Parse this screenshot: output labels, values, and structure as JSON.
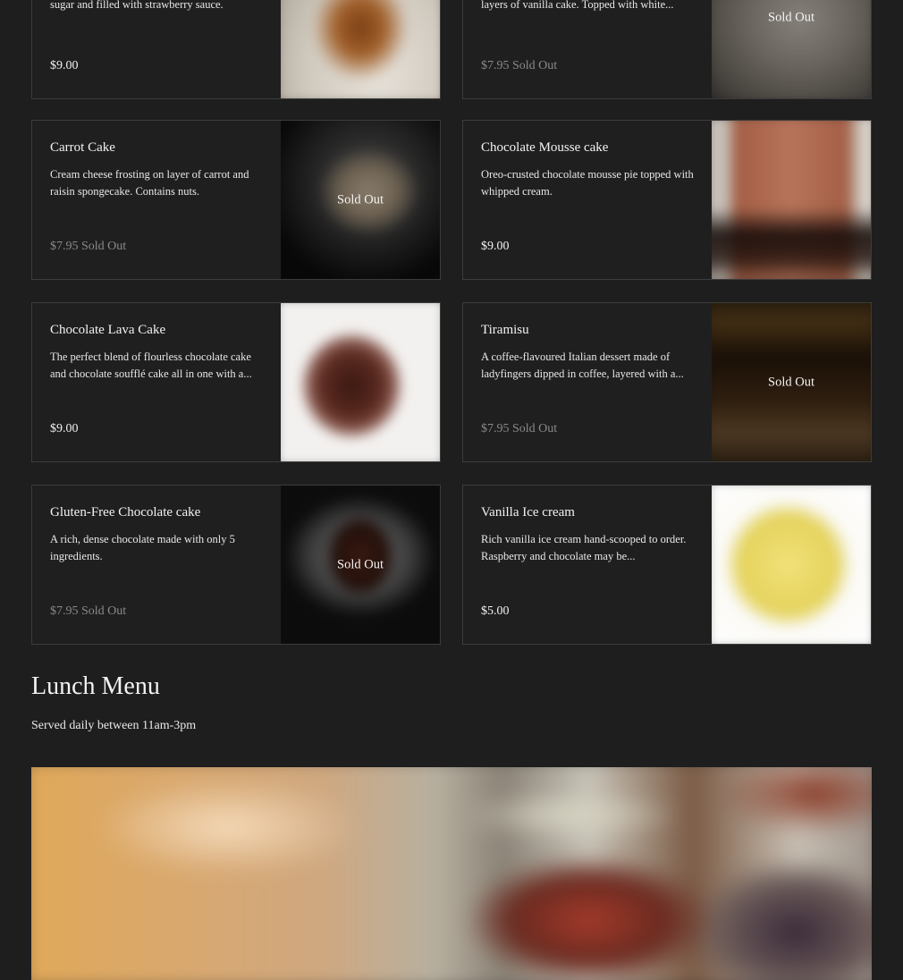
{
  "dessert_items": [
    {
      "name": "",
      "description": "sugar and filled with strawberry sauce.",
      "price": "$9.00",
      "sold_out_label": ""
    },
    {
      "name": "",
      "description": "layers of vanilla cake. Topped with white...",
      "price": "$7.95 Sold Out",
      "sold_out_label": "Sold Out"
    },
    {
      "name": "Carrot Cake",
      "description": "Cream cheese frosting on layer of carrot and raisin spongecake. Contains nuts.",
      "price": "$7.95 Sold Out",
      "sold_out_label": "Sold Out"
    },
    {
      "name": "Chocolate Mousse cake",
      "description": "Oreo-crusted chocolate mousse pie topped with whipped cream.",
      "price": "$9.00",
      "sold_out_label": ""
    },
    {
      "name": "Chocolate Lava Cake",
      "description": "The perfect blend of flourless chocolate cake and chocolate soufflé cake all in one with a...",
      "price": "$9.00",
      "sold_out_label": ""
    },
    {
      "name": "Tiramisu",
      "description": "A coffee-flavoured Italian dessert made of ladyfingers dipped in coffee, layered with a...",
      "price": "$7.95 Sold Out",
      "sold_out_label": "Sold Out"
    },
    {
      "name": "Gluten-Free Chocolate cake",
      "description": "A rich, dense chocolate made with only 5 ingredients.",
      "price": "$7.95 Sold Out",
      "sold_out_label": "Sold Out"
    },
    {
      "name": "Vanilla Ice cream",
      "description": "Rich vanilla ice cream hand-scooped to order. Raspberry and chocolate may be...",
      "price": "$5.00",
      "sold_out_label": ""
    }
  ],
  "lunch": {
    "title": "Lunch Menu",
    "subtitle": "Served daily between 11am-3pm"
  },
  "colors": {
    "background": "#1e1e1e",
    "card_border": "#3c3c3c",
    "text": "#f3f3f3",
    "sold_out_price": "#8a8a8a"
  }
}
